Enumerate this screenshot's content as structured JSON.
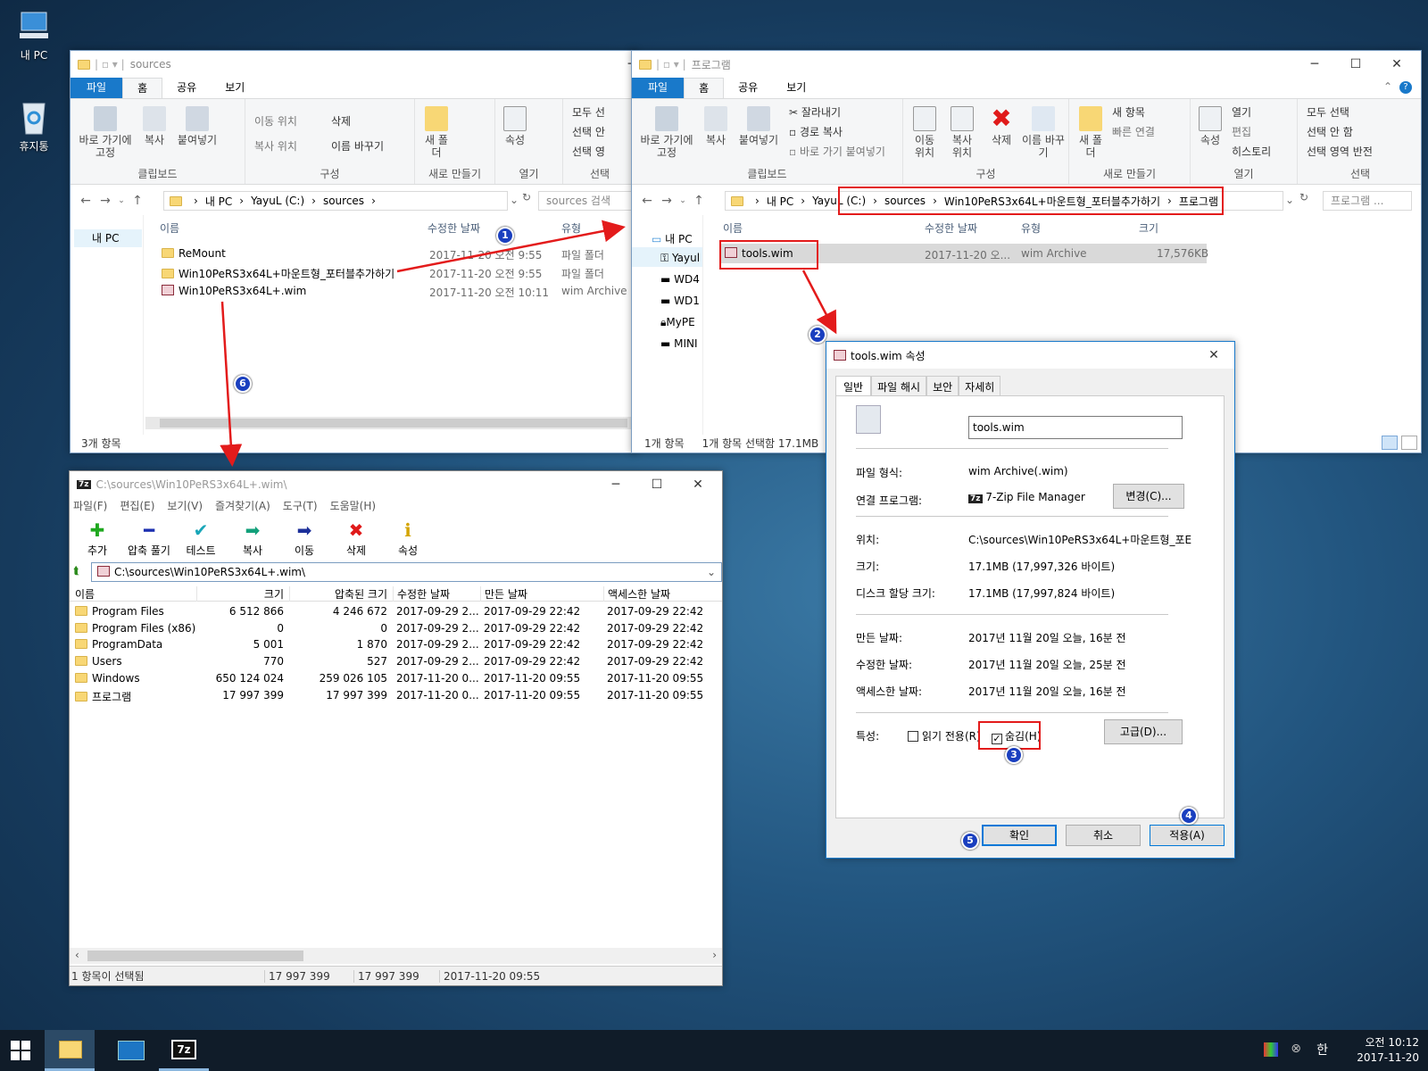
{
  "desktop": {
    "icons": [
      {
        "label": "내 PC",
        "icon": "pc-icon"
      },
      {
        "label": "휴지통",
        "icon": "recycle-bin-icon"
      }
    ]
  },
  "explorer1": {
    "title": "sources",
    "tabs": [
      "파일",
      "홈",
      "공유",
      "보기"
    ],
    "ribbon": {
      "pin": "바로 가기에 고정",
      "copy": "복사",
      "paste": "붙여넣기",
      "clipboard": "클립보드",
      "move_to": "이동 위치",
      "copy_to": "복사 위치",
      "delete": "삭제",
      "rename": "이름 바꾸기",
      "organize": "구성",
      "new_folder": "새 폴더",
      "new": "새로 만들기",
      "properties": "속성",
      "open": "열기",
      "select_all": "모두 선",
      "select_none": "선택 안",
      "invert": "선택 영",
      "select": "선택"
    },
    "address": [
      "내 PC",
      "YayuL (C:)",
      "sources"
    ],
    "search_placeholder": "sources 검색",
    "nav_item": "내 PC",
    "columns": [
      "이름",
      "수정한 날짜",
      "유형"
    ],
    "rows": [
      {
        "name": "ReMount",
        "date": "2017-11-20 오전 9:55",
        "type": "파일 폴더"
      },
      {
        "name": "Win10PeRS3x64L+마운트형_포터블추가하기",
        "date": "2017-11-20 오전 9:55",
        "type": "파일 폴더"
      },
      {
        "name": "Win10PeRS3x64L+.wim",
        "date": "2017-11-20 오전 10:11",
        "type": "wim Archive"
      }
    ],
    "status": "3개 항목"
  },
  "explorer2": {
    "title": "프로그램",
    "tabs": [
      "파일",
      "홈",
      "공유",
      "보기"
    ],
    "ribbon": {
      "pin": "바로 가기에 고정",
      "copy": "복사",
      "paste": "붙여넣기",
      "cut": "잘라내기",
      "copy_path": "경로 복사",
      "paste_shortcut": "바로 가기 붙여넣기",
      "clipboard": "클립보드",
      "move_to": "이동 위치",
      "copy_to": "복사 위치",
      "delete": "삭제",
      "rename": "이름 바꾸기",
      "organize": "구성",
      "new_folder": "새 폴더",
      "new_item": "새 항목",
      "easy_access": "빠른 연결",
      "new": "새로 만들기",
      "properties": "속성",
      "open_btn": "열기",
      "edit": "편집",
      "history": "히스토리",
      "open": "열기",
      "select_all": "모두 선택",
      "select_none": "선택 안 함",
      "invert": "선택 영역 반전",
      "select": "선택"
    },
    "address": [
      "내 PC",
      "YayuL (C:)",
      "sources",
      "Win10PeRS3x64L+마운트형_포터블추가하기",
      "프로그램"
    ],
    "search_placeholder": "프로그램 ...",
    "nav": [
      "내 PC",
      "Yayul",
      "WD4",
      "WD1",
      "MyPE",
      "MINI"
    ],
    "columns": [
      "이름",
      "수정한 날짜",
      "유형",
      "크기"
    ],
    "rows": [
      {
        "name": "tools.wim",
        "date": "2017-11-20 오...",
        "type": "wim Archive",
        "size": "17,576KB"
      }
    ],
    "status_count": "1개 항목",
    "status_sel": "1개 항목 선택함 17.1MB"
  },
  "props": {
    "title": "tools.wim 속성",
    "tabs": [
      "일반",
      "파일 해시",
      "보안",
      "자세히"
    ],
    "filename": "tools.wim",
    "type_label": "파일 형식:",
    "type_value": "wim Archive(.wim)",
    "opens_label": "연결 프로그램:",
    "opens_value": "7-Zip File Manager",
    "change": "변경(C)...",
    "location_label": "위치:",
    "location_value": "C:\\sources\\Win10PeRS3x64L+마운트형_포E",
    "size_label": "크기:",
    "size_value": "17.1MB (17,997,326 바이트)",
    "disk_label": "디스크 할당 크기:",
    "disk_value": "17.1MB (17,997,824 바이트)",
    "created_label": "만든 날짜:",
    "created_value": "2017년 11월 20일 오늘, 16분 전",
    "modified_label": "수정한 날짜:",
    "modified_value": "2017년 11월 20일 오늘, 25분 전",
    "accessed_label": "액세스한 날짜:",
    "accessed_value": "2017년 11월 20일 오늘, 16분 전",
    "attr_label": "특성:",
    "readonly": "읽기 전용(R)",
    "hidden": "숨김(H)",
    "hidden_checked": true,
    "advanced": "고급(D)...",
    "ok": "확인",
    "cancel": "취소",
    "apply": "적용(A)"
  },
  "sevenzip": {
    "title": "C:\\sources\\Win10PeRS3x64L+.wim\\",
    "menu": [
      "파일(F)",
      "편집(E)",
      "보기(V)",
      "즐겨찾기(A)",
      "도구(T)",
      "도움말(H)"
    ],
    "toolbar": [
      {
        "label": "추가",
        "icon": "add-icon",
        "color": "#1fa81f",
        "glyph": "✚"
      },
      {
        "label": "압축 풀기",
        "icon": "extract-icon",
        "color": "#1c2fb0",
        "glyph": "━"
      },
      {
        "label": "테스트",
        "icon": "test-icon",
        "color": "#19a6b8",
        "glyph": "✔"
      },
      {
        "label": "복사",
        "icon": "copy-icon",
        "color": "#12a07a",
        "glyph": "➡"
      },
      {
        "label": "이동",
        "icon": "move-icon",
        "color": "#1c2f9a",
        "glyph": "➡"
      },
      {
        "label": "삭제",
        "icon": "delete-icon",
        "color": "#e01a1a",
        "glyph": "✖"
      },
      {
        "label": "속성",
        "icon": "info-icon",
        "color": "#d4a400",
        "glyph": "ℹ"
      }
    ],
    "path": "C:\\sources\\Win10PeRS3x64L+.wim\\",
    "columns": [
      "이름",
      "크기",
      "압축된 크기",
      "수정한 날짜",
      "만든 날짜",
      "액세스한 날짜"
    ],
    "rows": [
      {
        "name": "Program Files",
        "size": "6 512 866",
        "packed": "4 246 672",
        "modified": "2017-09-29 2...",
        "created": "2017-09-29 22:42",
        "accessed": "2017-09-29 22:42"
      },
      {
        "name": "Program Files (x86)",
        "size": "0",
        "packed": "0",
        "modified": "2017-09-29 2...",
        "created": "2017-09-29 22:42",
        "accessed": "2017-09-29 22:42"
      },
      {
        "name": "ProgramData",
        "size": "5 001",
        "packed": "1 870",
        "modified": "2017-09-29 2...",
        "created": "2017-09-29 22:42",
        "accessed": "2017-09-29 22:42"
      },
      {
        "name": "Users",
        "size": "770",
        "packed": "527",
        "modified": "2017-09-29 2...",
        "created": "2017-09-29 22:42",
        "accessed": "2017-09-29 22:42"
      },
      {
        "name": "Windows",
        "size": "650 124 024",
        "packed": "259 026 105",
        "modified": "2017-11-20 0...",
        "created": "2017-11-20 09:55",
        "accessed": "2017-11-20 09:55"
      },
      {
        "name": "프로그램",
        "size": "17 997 399",
        "packed": "17 997 399",
        "modified": "2017-11-20 0...",
        "created": "2017-11-20 09:55",
        "accessed": "2017-11-20 09:55"
      }
    ],
    "status": [
      "1 항목이 선택됨",
      "17 997 399",
      "17 997 399",
      "2017-11-20 09:55"
    ]
  },
  "badges": [
    "1",
    "2",
    "3",
    "4",
    "5",
    "6"
  ],
  "taskbar": {
    "time": "오전 10:12",
    "date": "2017-11-20",
    "ime": "한"
  },
  "colors": {
    "accent": "#1979ca",
    "annotation_red": "#e31b1b",
    "badge_blue": "#1a3fbf"
  }
}
